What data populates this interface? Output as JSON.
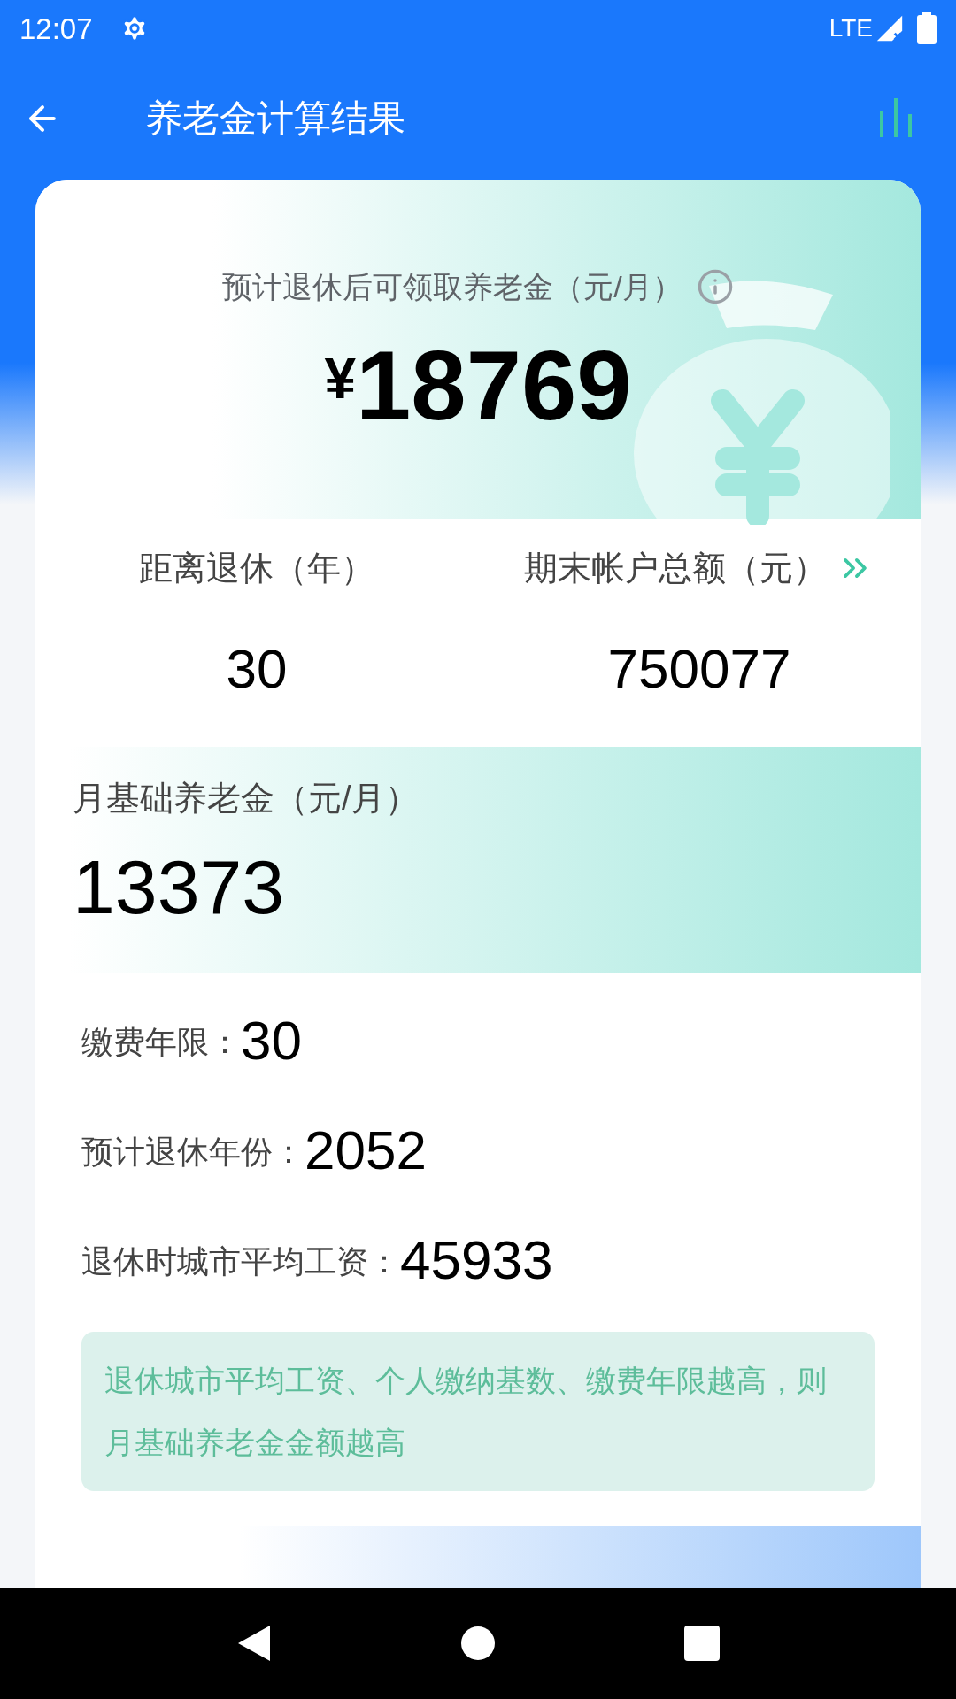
{
  "status_bar": {
    "time": "12:07",
    "network": "LTE"
  },
  "app_bar": {
    "title": "养老金计算结果"
  },
  "hero": {
    "label": "预计退休后可领取养老金（元/月）",
    "currency": "¥",
    "amount": "18769"
  },
  "stats": [
    {
      "label": "距离退休（年）",
      "value": "30",
      "more": false
    },
    {
      "label": "期末帐户总额（元）",
      "value": "750077",
      "more": true
    }
  ],
  "basic_pension": {
    "label": "月基础养老金（元/月）",
    "value": "13373"
  },
  "details": [
    {
      "label": "缴费年限：",
      "value": "30"
    },
    {
      "label": "预计退休年份：",
      "value": "2052"
    },
    {
      "label": "退休时城市平均工资：",
      "value": "45933"
    }
  ],
  "tip": "退休城市平均工资、个人缴纳基数、缴费年限越高，则月基础养老金金额越高"
}
